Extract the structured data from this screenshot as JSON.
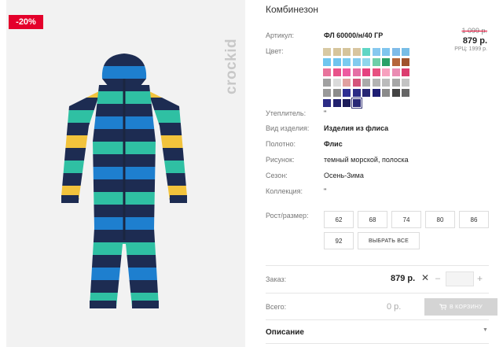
{
  "badge": {
    "discount": "-20%"
  },
  "brand": {
    "logo_text": "crockid"
  },
  "product": {
    "title": "Комбинезон",
    "article_label": "Артикул:",
    "article_value": "ФЛ 60000/н/40 ГР",
    "color_label": "Цвет:",
    "price_old": "1 099 р.",
    "price_new": "879 р.",
    "price_rrc": "РРЦ: 1999 р."
  },
  "swatches": [
    "#d8c9a3",
    "#d6c59c",
    "#d5c49b",
    "#d8c5a0",
    "#5fd6c5",
    "#86c8ef",
    "#7fc5ee",
    "#7fbbe8",
    "#78bde6",
    "#6fc6ef",
    "#6fc4ee",
    "#79cbf0",
    "#83cbef",
    "#8fd6ec",
    "#6fcfa9",
    "#2aa167",
    "#b5653a",
    "#a0522d",
    "#e8749c",
    "#e8528a",
    "#ed5aa0",
    "#e56fa5",
    "#e5407f",
    "#e75080",
    "#f7a0be",
    "#ea8cb3",
    "#db3d6f",
    "#a1a1a1",
    "#dadada",
    "#e1a0a0",
    "#d4547b",
    "#aaaaaa",
    "#b3b3b3",
    "#bbbbbb",
    "#a7a7a7",
    "#c3c3c3",
    "#9a9a9a",
    "#8c8c8c",
    "#2f2f92",
    "#2c2c85",
    "#292975",
    "#1e1e73",
    "#8a8a8a",
    "#444444",
    "#666666",
    "#2d2d86",
    "#22226e",
    "#1c1c59",
    "#262675"
  ],
  "specs": [
    {
      "label": "Утеплитель:",
      "value": "\""
    },
    {
      "label": "Вид изделия:",
      "value": "Изделия из флиса"
    },
    {
      "label": "Полотно:",
      "value": "Флис"
    },
    {
      "label": "Рисунок:",
      "value": "темный морской, полоска"
    },
    {
      "label": "Сезон:",
      "value": "Осень-Зима"
    },
    {
      "label": "Коллекция:",
      "value": "\""
    }
  ],
  "size": {
    "label": "Рост/размер:",
    "options": [
      "62",
      "68",
      "74",
      "80",
      "86",
      "92"
    ],
    "select_all": "ВЫБРАТЬ ВСЕ"
  },
  "order": {
    "label": "Заказ:",
    "price": "879 р.",
    "x": "✕",
    "minus": "–",
    "plus": "+",
    "qty": ""
  },
  "total": {
    "label": "Всего:",
    "value": "0 р.",
    "cart_button": "В КОРЗИНУ"
  },
  "description": {
    "title": "Описание",
    "chevron": "▼"
  }
}
